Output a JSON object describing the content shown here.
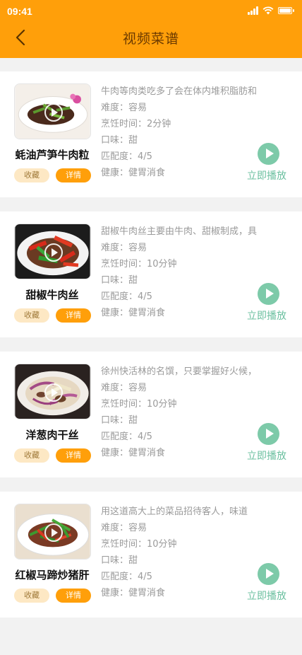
{
  "status_bar": {
    "time": "09:41"
  },
  "header": {
    "title": "视频菜谱"
  },
  "recipes": [
    {
      "name": "蚝油芦笋牛肉粒",
      "collect_label": "收藏",
      "detail_label": "详情",
      "description": "牛肉等肉类吃多了会在体内堆积脂肪和",
      "difficulty": "难度：容易",
      "cook_time": "烹饪时间：2分钟",
      "taste": " 口味：甜",
      "match": "匹配度：4/5",
      "health": "健康：健胃消食",
      "play_label": "立即播放"
    },
    {
      "name": "甜椒牛肉丝",
      "collect_label": "收藏",
      "detail_label": "详情",
      "description": "甜椒牛肉丝主要由牛肉、甜椒制成，具",
      "difficulty": "难度：容易",
      "cook_time": "烹饪时间：10分钟",
      "taste": "口味：甜",
      "match": "匹配度：4/5",
      "health": "健康：健胃消食",
      "play_label": "立即播放"
    },
    {
      "name": "洋葱肉干丝",
      "collect_label": "收藏",
      "detail_label": "详情",
      "description": "徐州快活林的名馔，只要掌握好火候，",
      "difficulty": "难度：容易",
      "cook_time": "烹饪时间：10分钟",
      "taste": "口味：甜",
      "match": "匹配度：4/5",
      "health": " 健康：健胃消食",
      "play_label": "立即播放"
    },
    {
      "name": "红椒马蹄炒猪肝",
      "collect_label": "收藏",
      "detail_label": "详情",
      "description": "用这道高大上的菜品招待客人，味道",
      "difficulty": "难度：容易",
      "cook_time": "烹饪时间：10分钟",
      "taste": "口味：甜",
      "match": "匹配度：4/5",
      "health": "健康：健胃消食",
      "play_label": "立即播放"
    }
  ],
  "colors": {
    "header": "#ff9f0a",
    "play": "#7dcaa9",
    "detail_button": "#ff9f0a",
    "collect_button": "#fde8c4"
  },
  "icons": {
    "back": "chevron-left-icon",
    "play": "play-circle-icon"
  }
}
